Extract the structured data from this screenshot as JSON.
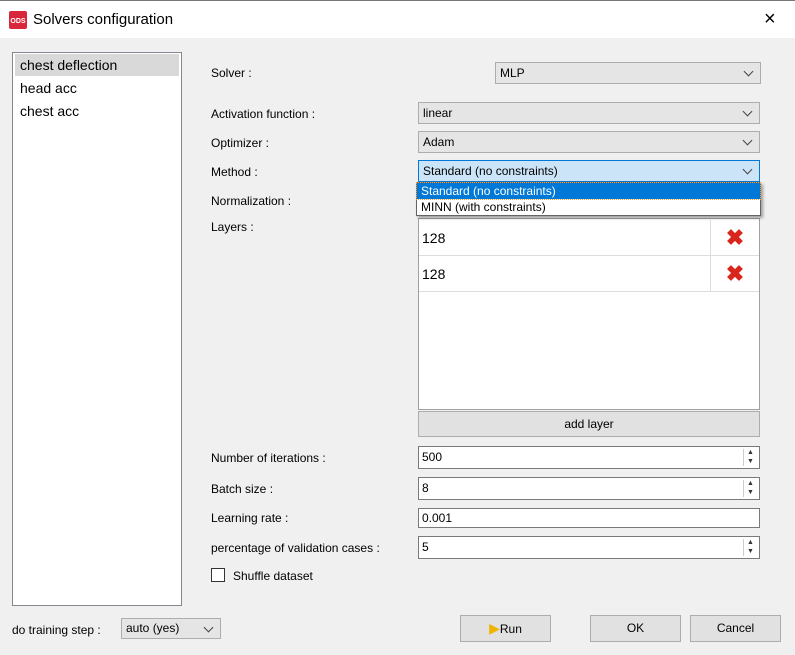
{
  "window": {
    "title": "Solvers configuration",
    "logo": "ODS",
    "close_icon": "×"
  },
  "outputs": [
    {
      "label": "chest deflection",
      "selected": true
    },
    {
      "label": "head acc"
    },
    {
      "label": "chest acc"
    }
  ],
  "form": {
    "solver_label": "Solver :",
    "solver_value": "MLP",
    "activation_label": "Activation function :",
    "activation_value": "linear",
    "optimizer_label": "Optimizer :",
    "optimizer_value": "Adam",
    "method_label": "Method :",
    "method_value": "Standard (no constraints)",
    "method_options": [
      "Standard (no constraints)",
      "MINN (with constraints)"
    ],
    "normalization_label": "Normalization :",
    "layers_label": "Layers :",
    "layers": [
      "128",
      "128"
    ],
    "add_layer": "add layer",
    "iterations_label": "Number of iterations :",
    "iterations_value": "500",
    "batch_label": "Batch size :",
    "batch_value": "8",
    "lr_label": "Learning rate :",
    "lr_value": "0.001",
    "validation_label": "percentage of validation cases :",
    "validation_value": "5",
    "shuffle_label": "Shuffle dataset",
    "shuffle_checked": false
  },
  "footer": {
    "training_label": "do training step :",
    "training_value": "auto (yes)",
    "run": "Run",
    "ok": "OK",
    "cancel": "Cancel"
  }
}
